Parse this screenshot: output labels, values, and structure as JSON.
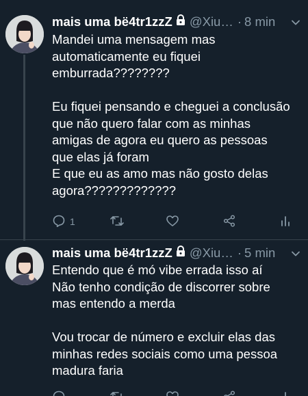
{
  "tweets": [
    {
      "author_name": "mais uma bë4tr1zzZ",
      "handle": "@Xiu…",
      "separator": "·",
      "time": "8 min",
      "lines": [
        "Mandei uma mensagem mas",
        "automaticamente eu fiquei",
        "emburrada????????",
        "",
        "Eu fiquei pensando e cheguei a conclusão",
        "que não quero falar com as minhas",
        "amigas de agora eu quero as pessoas",
        "que elas já foram",
        "E que eu as amo mas não gosto delas",
        "agora?????????????"
      ],
      "reply_count": "1"
    },
    {
      "author_name": "mais uma bë4tr1zzZ",
      "handle": "@Xiu…",
      "separator": "·",
      "time": "5 min",
      "lines": [
        "Entendo que é mó vibe errada isso aí",
        "Não tenho condição de discorrer sobre",
        "mas entendo a merda",
        "",
        "Vou trocar de número e excluir elas das",
        "minhas redes sociais como uma pessoa",
        "madura faria"
      ]
    }
  ],
  "icons": {
    "lock": "lock-icon",
    "chevron": "chevron-down-icon",
    "reply": "reply-icon",
    "retweet": "retweet-icon",
    "like": "heart-icon",
    "share": "share-icon",
    "analytics": "analytics-icon"
  },
  "colors": {
    "background": "#15202b",
    "secondary_text": "#8899a6",
    "divider": "#38444d"
  }
}
